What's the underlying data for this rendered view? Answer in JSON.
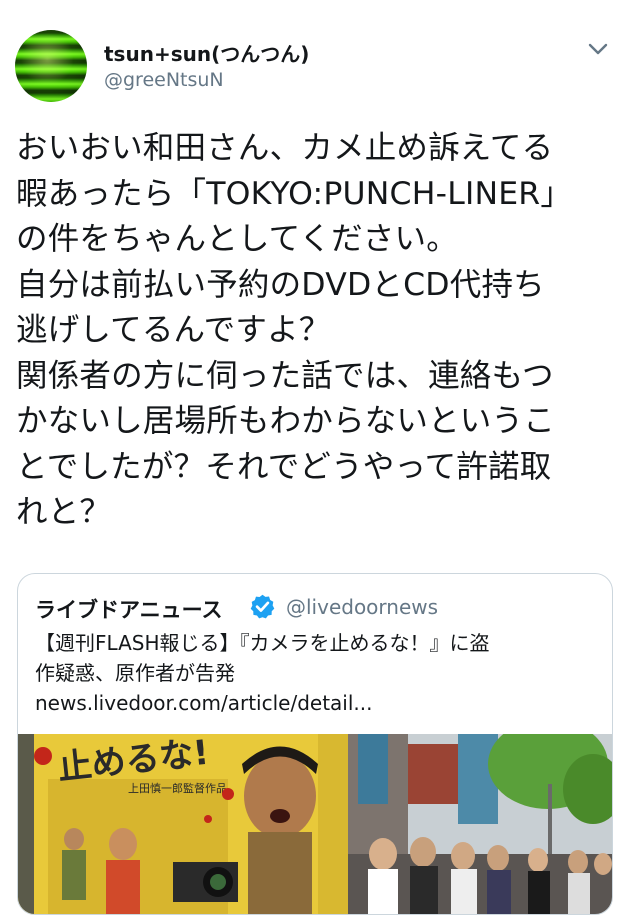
{
  "tweet": {
    "display_name": "tsun+sun(つんつん)",
    "handle": "@greeNtsuN",
    "text_lines": [
      "おいおい和田さん、カメ止め訴えてる",
      "暇あったら「TOKYO:PUNCH-LINER」",
      "の件をちゃんとしてください。",
      "自分は前払い予約のDVDとCD代持ち",
      "逃げしてるんですよ？",
      "関係者の方に伺った話では、連絡もつ",
      "かないし居場所もわからないというこ",
      "とでしたが？それでどうやって許諾取",
      "れと？"
    ]
  },
  "card": {
    "source_name": "ライブドアニュース",
    "source_handle": "@livedoornews",
    "title_lines": [
      "【週刊FLASH報じる】『カメラを止めるな！』に盗",
      "作疑惑、原作者が告発"
    ],
    "url": "news.livedoor.com/article/detail...",
    "poster_text": "止めるな!",
    "poster_credit": "上田慎一郎監督作品"
  },
  "icons": {
    "avatar": "green-glitch-avatar",
    "caret": "chevron-down-icon",
    "verified": "verified-badge-icon"
  },
  "colors": {
    "text": "#14171a",
    "secondary": "#657786",
    "verified": "#1da1f2",
    "border": "#ccd6dd"
  }
}
